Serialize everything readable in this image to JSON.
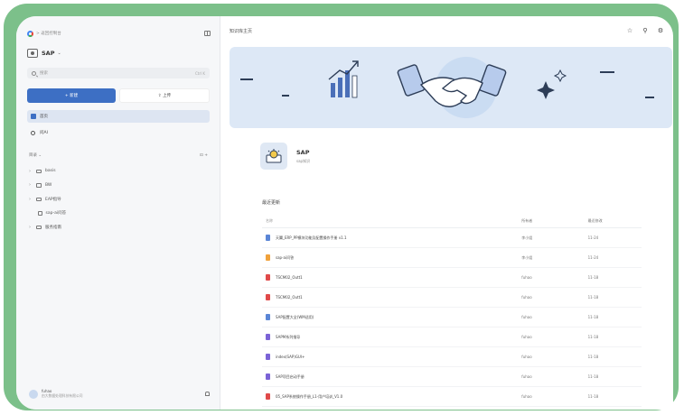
{
  "sidebar": {
    "breadcrumb": "> 返回控制台",
    "workspace_name": "SAP",
    "workspace_caret": "⌄",
    "search_placeholder": "搜索",
    "search_shortcut": "Ctrl K",
    "new_label": "+ 新建",
    "upload_label": "⇪ 上传",
    "nav": [
      {
        "label": "首页",
        "active": true
      },
      {
        "label": "问AI",
        "active": false
      }
    ],
    "directory_label": "目录 ⌄",
    "directory_actions": "⊡ +",
    "tree": [
      {
        "label": "basis",
        "type": "folder"
      },
      {
        "label": "BW",
        "type": "folder"
      },
      {
        "label": "EAP指导",
        "type": "folder"
      },
      {
        "label": "sap-ai问答",
        "type": "doc"
      },
      {
        "label": "服务指南",
        "type": "folder"
      }
    ],
    "user_name": "fuhao",
    "user_org": "由大数据处理科技有限公司",
    "colors": {
      "accent": "#3d6fc4",
      "active_bg": "#dde5f2"
    }
  },
  "main": {
    "page_title": "知识库主页",
    "toolbar_icons": [
      "star-icon",
      "pin-icon",
      "settings-icon"
    ],
    "workspace": {
      "name": "SAP",
      "desc": "sap知识"
    },
    "recent_title": "最近更新",
    "table": {
      "headers": [
        "名称",
        "所有者",
        "最近修改"
      ],
      "rows": [
        {
          "name": "天翼_ERP_PP模块功能及配置操作手册 v1.1",
          "owner": "李小姐",
          "time": "11-24",
          "color": "#5b86d6"
        },
        {
          "name": "sap-ai问答",
          "owner": "李小姐",
          "time": "11-24",
          "color": "#f0a23c"
        },
        {
          "name": "TSCM02_Outt1",
          "owner": "fuhao",
          "time": "11-18",
          "color": "#e04a4a"
        },
        {
          "name": "TSCM02_Outt1",
          "owner": "fuhao",
          "time": "11-18",
          "color": "#e04a4a"
        },
        {
          "name": "SAP配置大全(WM适用)",
          "owner": "fuhao",
          "time": "11-18",
          "color": "#5b86d6"
        },
        {
          "name": "SAPM系列指导",
          "owner": "fuhao",
          "time": "11-18",
          "color": "#7b63d6"
        },
        {
          "name": "index(SAP)GUI+",
          "owner": "fuhao",
          "time": "11-18",
          "color": "#7b63d6"
        },
        {
          "name": "SAP项目启动手册",
          "owner": "fuhao",
          "time": "11-18",
          "color": "#7b63d6"
        },
        {
          "name": "05_SAP系统操作手册_L1-用户培训_V1.0",
          "owner": "fuhao",
          "time": "11-18",
          "color": "#e04a4a"
        }
      ]
    }
  }
}
